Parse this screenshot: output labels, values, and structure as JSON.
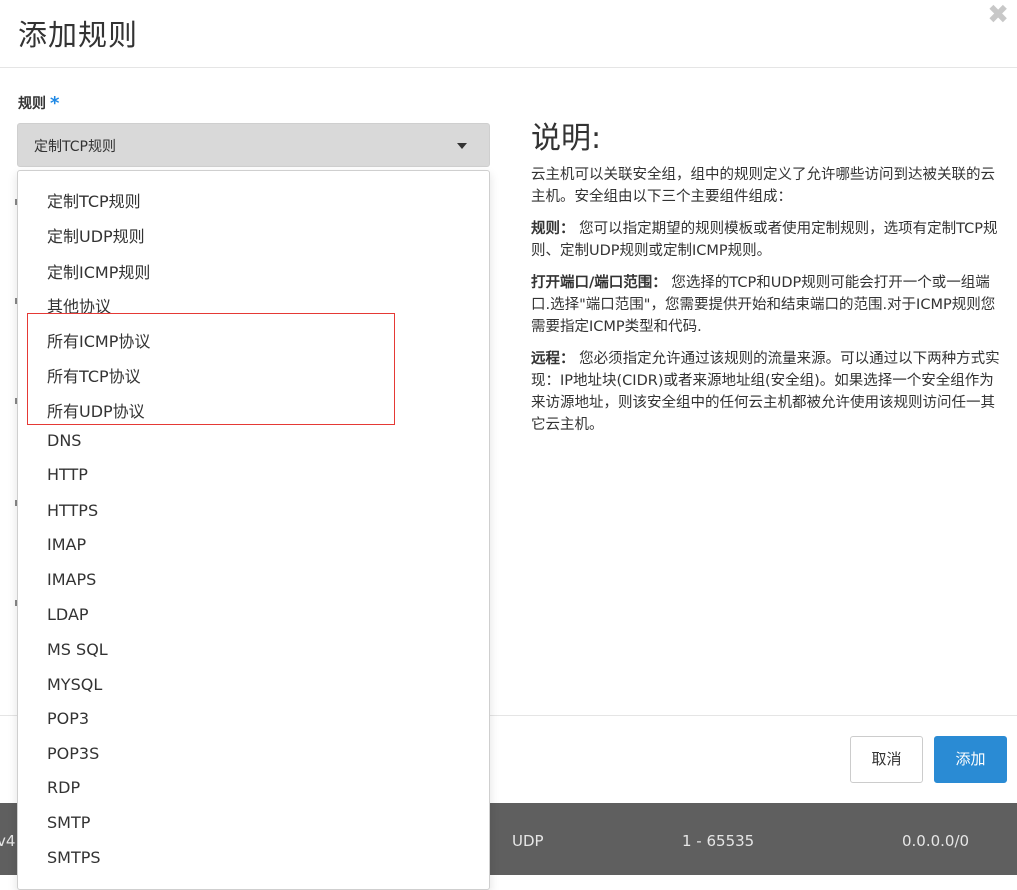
{
  "modal": {
    "title": "添加规则",
    "close_icon": "close-icon"
  },
  "rule_field": {
    "label": "规则",
    "required_mark": "*",
    "selected": "定制TCP规则"
  },
  "dropdown": {
    "options": [
      "定制TCP规则",
      "定制UDP规则",
      "定制ICMP规则",
      "其他协议",
      "所有ICMP协议",
      "所有TCP协议",
      "所有UDP协议",
      "DNS",
      "HTTP",
      "HTTPS",
      "IMAP",
      "IMAPS",
      "LDAP",
      "MS SQL",
      "MYSQL",
      "POP3",
      "POP3S",
      "RDP",
      "SMTP",
      "SMTPS"
    ]
  },
  "help": {
    "title": "说明:",
    "intro": "云主机可以关联安全组，组中的规则定义了允许哪些访问到达被关联的云主机。安全组由以下三个主要组件组成：",
    "rule_term": "规则：",
    "rule_text": "您可以指定期望的规则模板或者使用定制规则，选项有定制TCP规则、定制UDP规则或定制ICMP规则。",
    "port_term": "打开端口/端口范围：",
    "port_text": "您选择的TCP和UDP规则可能会打开一个或一组端口.选择\"端口范围\"，您需要提供开始和结束端口的范围.对于ICMP规则您需要指定ICMP类型和代码.",
    "remote_term": "远程：",
    "remote_text": "您必须指定允许通过该规则的流量来源。可以通过以下两种方式实现：IP地址块(CIDR)或者来源地址组(安全组)。如果选择一个安全组作为来访源地址，则该安全组中的任何云主机都被允许使用该规则访问任一其它云主机。"
  },
  "footer": {
    "cancel_label": "取消",
    "add_label": "添加"
  },
  "background_row": {
    "ether_type": "v4",
    "protocol": "UDP",
    "port_range": "1 - 65535",
    "remote": "0.0.0.0/0"
  },
  "colors": {
    "primary": "#2a8bd4",
    "required": "#1e88e5",
    "highlight": "#e53935"
  }
}
